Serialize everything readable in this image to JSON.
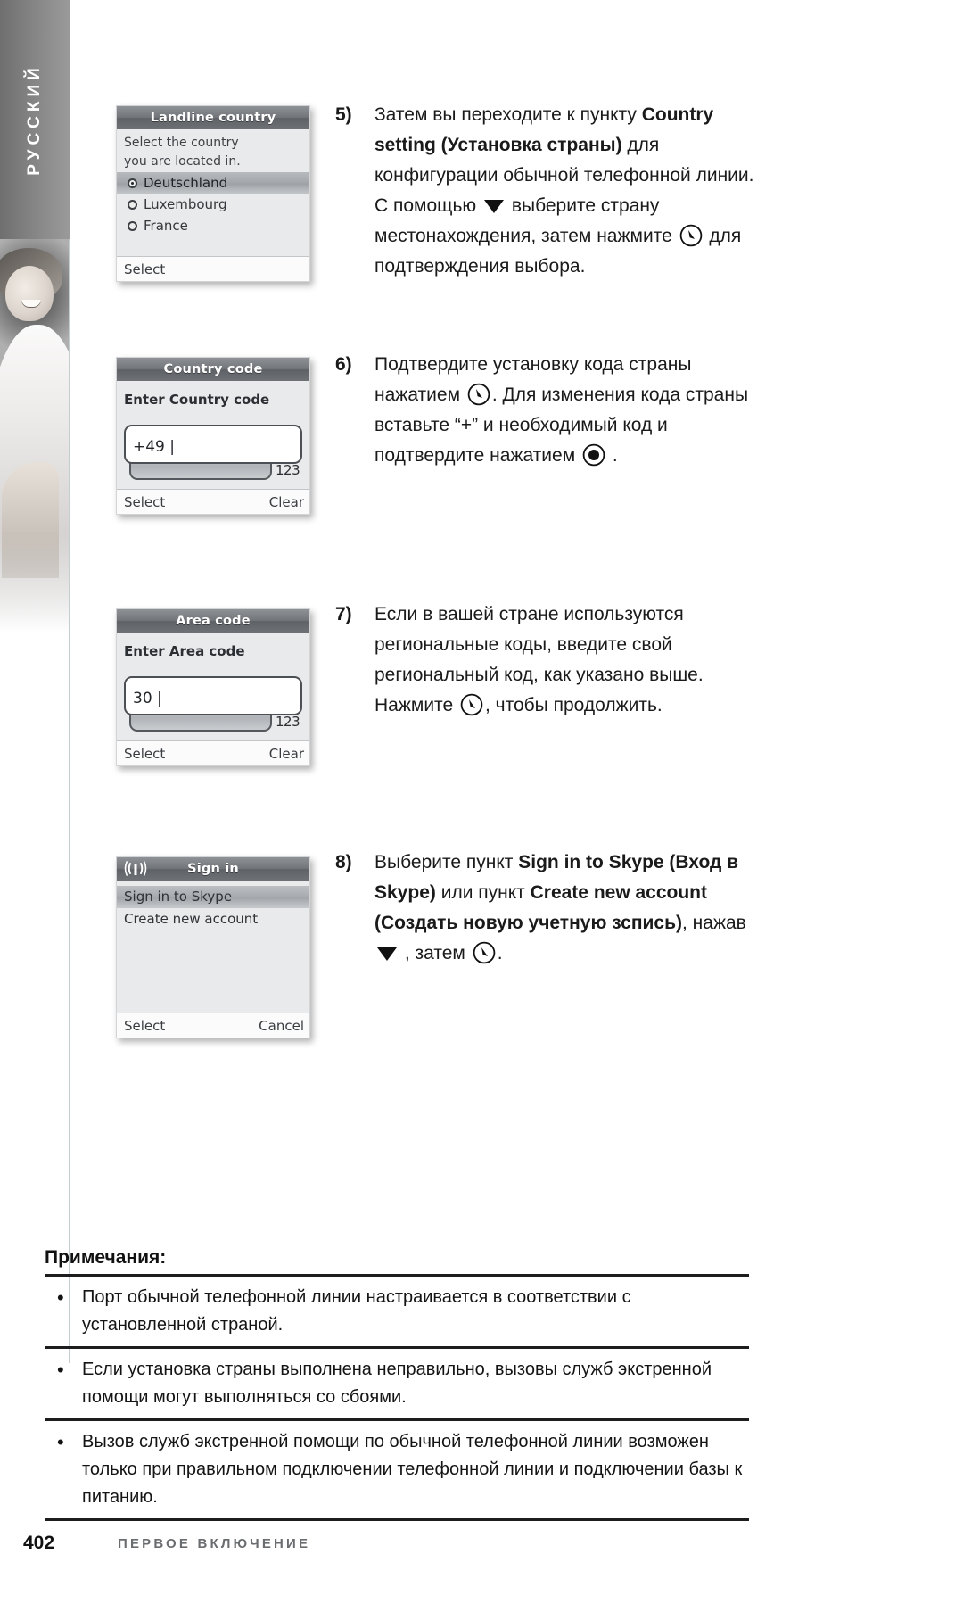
{
  "sidebar": {
    "language_tab": "РУССКИЙ",
    "photo_alt": "woman-photo"
  },
  "screens": [
    {
      "id": "landline-country",
      "title": "Landline country",
      "hint_lines": [
        "Select the country",
        "you are located in."
      ],
      "options": [
        {
          "label": "Deutschland",
          "selected": true
        },
        {
          "label": "Luxembourg",
          "selected": false
        },
        {
          "label": "France",
          "selected": false
        }
      ],
      "softkeys": {
        "left": "Select",
        "right": ""
      }
    },
    {
      "id": "country-code",
      "title": "Country code",
      "prompt": "Enter Country code",
      "value": "+49",
      "ime": "123",
      "softkeys": {
        "left": "Select",
        "right": "Clear"
      }
    },
    {
      "id": "area-code",
      "title": "Area code",
      "prompt": "Enter Area code",
      "value": "30",
      "ime": "123",
      "softkeys": {
        "left": "Select",
        "right": "Clear"
      }
    },
    {
      "id": "sign-in",
      "title": "Sign in",
      "status_icon": "signal-antenna-icon",
      "menu": [
        {
          "label": "Sign in to Skype",
          "selected": true
        },
        {
          "label": "Create new account",
          "selected": false
        }
      ],
      "softkeys": {
        "left": "Select",
        "right": "Cancel"
      }
    }
  ],
  "steps": [
    {
      "number": "5)",
      "parts": [
        {
          "t": "Затем вы переходите к пункту "
        },
        {
          "t": "Country setting (Установка страны)",
          "b": true
        },
        {
          "t": " для конфигурации обычной телефонной линии. С помощью "
        },
        {
          "icon": "down-triangle-icon"
        },
        {
          "t": " выберите страну местонахождения, затем нажмите "
        },
        {
          "icon": "ok-key-icon"
        },
        {
          "t": " для подтверждения выбора."
        }
      ]
    },
    {
      "number": "6)",
      "parts": [
        {
          "t": "Подтвердите установку кода страны нажатием "
        },
        {
          "icon": "ok-key-icon"
        },
        {
          "t": ". Для изменения кода страны вставьте “+” и необходимый код и подтвердите нажатием "
        },
        {
          "icon": "ok-key-filled-icon"
        },
        {
          "t": " ."
        }
      ]
    },
    {
      "number": "7)",
      "parts": [
        {
          "t": "Если в вашей стране используются региональные коды, введите свой региональный код, как указано выше. Нажмите "
        },
        {
          "icon": "ok-key-icon"
        },
        {
          "t": ", чтобы продолжить."
        }
      ]
    },
    {
      "number": "8)",
      "parts": [
        {
          "t": "Выберите пункт "
        },
        {
          "t": "Sign in to Skype (Вход в Skype)",
          "b": true
        },
        {
          "t": " или пункт "
        },
        {
          "t": "Create new account (Создать новую учетную зспись)",
          "b": true
        },
        {
          "t": ", нажав "
        },
        {
          "icon": "down-triangle-icon"
        },
        {
          "t": " , затем "
        },
        {
          "icon": "ok-key-icon"
        },
        {
          "t": "."
        }
      ]
    }
  ],
  "notes": {
    "title": "Примечания:",
    "bullet": "•",
    "items": [
      "Порт обычной телефонной линии настраивается в соответствии с установленной страной.",
      "Если установка страны выполнена неправильно, вызовы служб экстренной помощи могут выполняться со сбоями.",
      "Вызов служб экстренной помощи по обычной телефонной линии возможен только при правильном подключении телефонной линии и подключении базы к питанию."
    ]
  },
  "footer": {
    "page_number": "402",
    "section": "ПЕРВОЕ ВКЛЮЧЕНИЕ"
  },
  "colors": {
    "rail": "#7d7d7d",
    "title_bar": "#6e7176",
    "text": "#1a1a1a",
    "footer_section": "#6a6d70"
  }
}
